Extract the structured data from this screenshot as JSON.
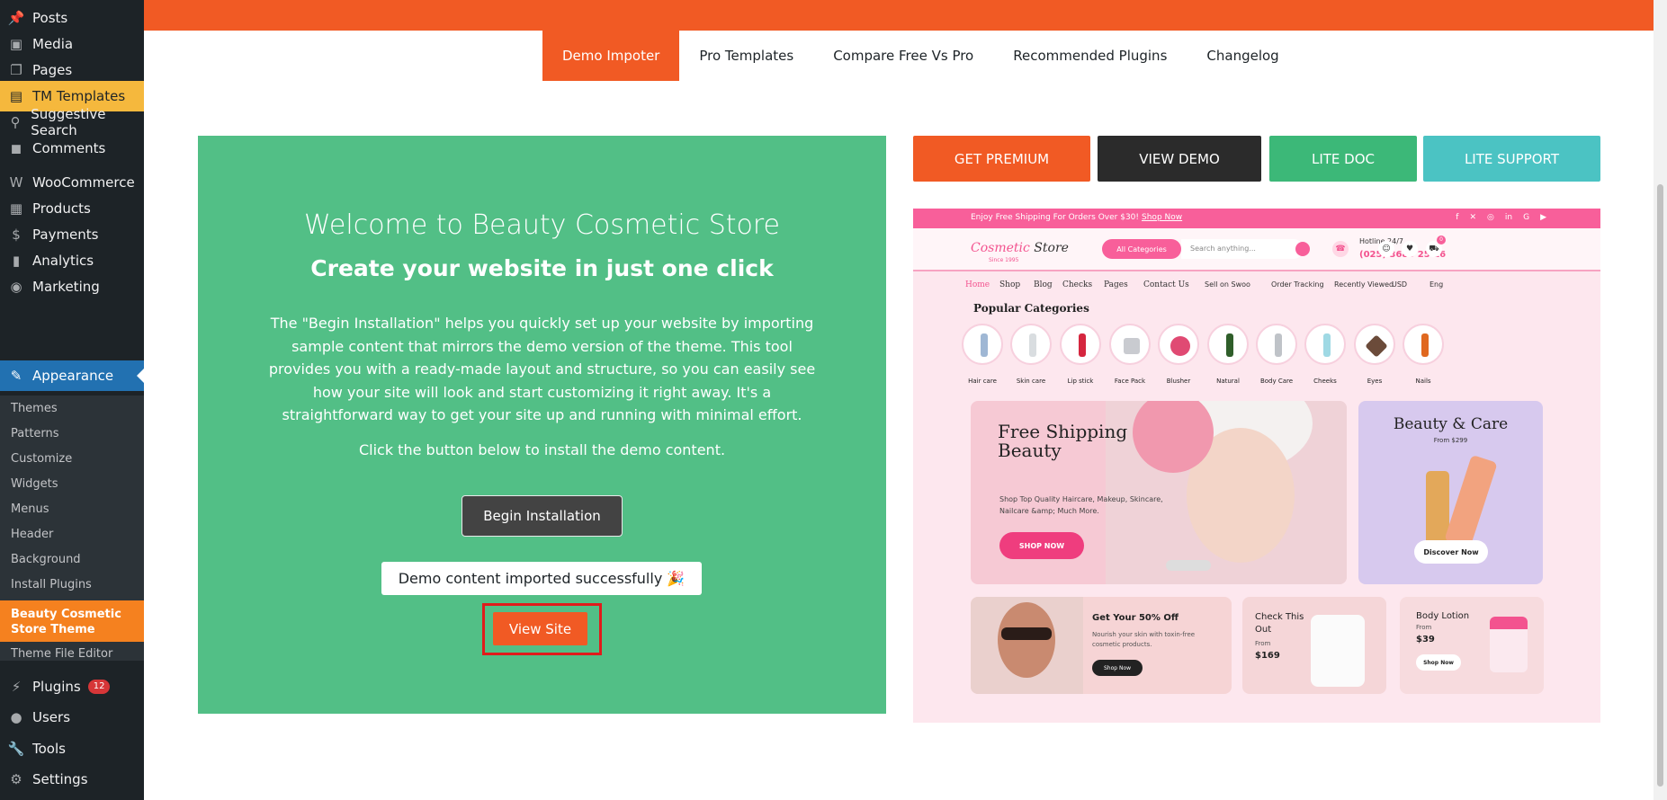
{
  "sidebar": {
    "items": [
      {
        "label": "Posts",
        "icon": "pin-icon"
      },
      {
        "label": "Media",
        "icon": "media-icon"
      },
      {
        "label": "Pages",
        "icon": "pages-icon"
      },
      {
        "label": "TM Templates",
        "icon": "templates-icon"
      },
      {
        "label": "Suggestive Search",
        "icon": "search-icon"
      },
      {
        "label": "Comments",
        "icon": "comment-icon"
      },
      {
        "label": "WooCommerce",
        "icon": "woo-icon"
      },
      {
        "label": "Products",
        "icon": "products-icon"
      },
      {
        "label": "Payments",
        "icon": "payments-icon"
      },
      {
        "label": "Analytics",
        "icon": "analytics-icon"
      },
      {
        "label": "Marketing",
        "icon": "marketing-icon"
      },
      {
        "label": "Appearance",
        "icon": "brush-icon"
      },
      {
        "label": "Plugins",
        "icon": "plugin-icon",
        "badge": "12"
      },
      {
        "label": "Users",
        "icon": "user-icon"
      },
      {
        "label": "Tools",
        "icon": "wrench-icon"
      },
      {
        "label": "Settings",
        "icon": "settings-icon"
      }
    ],
    "appearance_submenu": [
      "Themes",
      "Patterns",
      "Customize",
      "Widgets",
      "Menus",
      "Header",
      "Background",
      "Install Plugins",
      "Beauty Cosmetic Store Theme",
      "Theme File Editor"
    ]
  },
  "tabs": [
    "Demo Impoter",
    "Pro Templates",
    "Compare Free Vs Pro",
    "Recommended Plugins",
    "Changelog"
  ],
  "welcome": {
    "title": "Welcome to Beauty Cosmetic Store",
    "subtitle": "Create your website in just one click",
    "description": "The \"Begin Installation\" helps you quickly set up your website by importing sample content that mirrors the demo version of the theme. This tool provides you with a ready-made layout and structure, so you can easily see how your site will look and start customizing it right away. It's a straightforward way to get your site up and running with minimal effort.",
    "click_text": "Click the button below to install the demo content.",
    "begin_button": "Begin Installation",
    "success_message": "Demo content imported successfully 🎉",
    "view_site_button": "View Site"
  },
  "actions": {
    "premium": "GET PREMIUM",
    "demo": "VIEW DEMO",
    "lite_doc": "LITE DOC",
    "lite_support": "LITE SUPPORT"
  },
  "preview": {
    "shipping_text": "Enjoy Free Shipping For Orders Over $30!",
    "shop_now_link": "Shop Now",
    "logo_a": "Cosmetic",
    "logo_b": " Store",
    "logo_sub": "Since 1995",
    "all_categories": "All Categories",
    "search_placeholder": "Search anything...",
    "hotline_label": "Hotline 24/7",
    "hotline_number": "(025) 3686 25 16",
    "cart_count": "0",
    "nav": [
      "Home",
      "Shop",
      "Blog",
      "Checks",
      "Pages",
      "Contact Us"
    ],
    "nav_right": [
      "Sell on Swoo",
      "Order Tracking",
      "Recently Viewed",
      "USD",
      "Eng"
    ],
    "popular_title": "Popular Categories",
    "categories": [
      "Hair care",
      "Skin care",
      "Lip stick",
      "Face Pack",
      "Blusher",
      "Natural",
      "Body Care",
      "Cheeks",
      "Eyes",
      "Nails"
    ],
    "hero_title": "Free Shipping Beauty",
    "hero_desc": "Shop Top Quality Haircare, Makeup, Skincare, Nailcare &amp; Much More.",
    "hero_button": "SHOP NOW",
    "beauty_title": "Beauty & Care",
    "beauty_from": "From $299",
    "beauty_button": "Discover Now",
    "card1_title": "Get Your 50% Off",
    "card1_desc": "Nourish your skin with toxin-free cosmetic products.",
    "card1_button": "Shop Now",
    "card2_title": "Check This Out",
    "card2_from": "From",
    "card2_price": "$169",
    "card3_title": "Body Lotion",
    "card3_from": "From",
    "card3_price": "$39",
    "card3_button": "Shop Now"
  },
  "colors": {
    "accent_orange": "#f15a24",
    "panel_green": "#52bf86",
    "view_demo": "#2b2b2b",
    "lite_doc": "#3cb878",
    "lite_support": "#4bc3c3",
    "wp_active": "#2271b1"
  }
}
